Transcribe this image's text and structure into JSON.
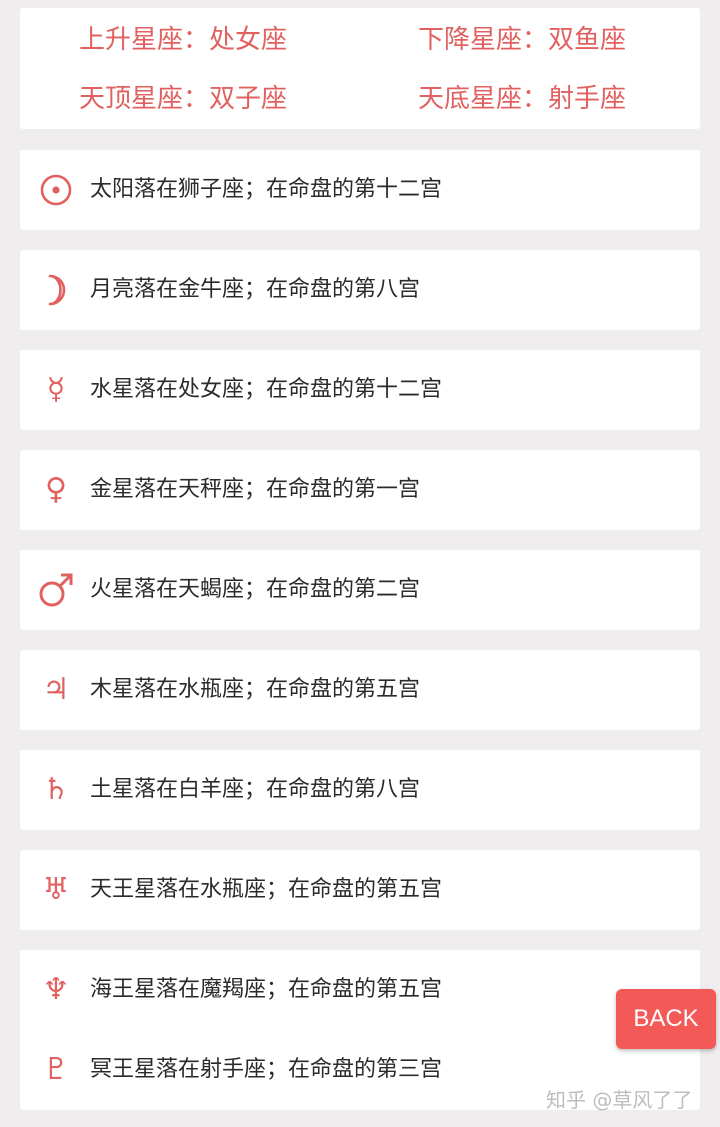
{
  "angles": {
    "ascendant": "上升星座：处女座",
    "descendant": "下降星座：双鱼座",
    "midheaven": "天顶星座：双子座",
    "imum_coeli": "天底星座：射手座"
  },
  "planets": [
    {
      "icon": "sun-icon",
      "glyph": "☉",
      "text": "太阳落在狮子座；在命盘的第十二宫"
    },
    {
      "icon": "moon-icon",
      "glyph": "☽",
      "text": "月亮落在金牛座；在命盘的第八宫"
    },
    {
      "icon": "mercury-icon",
      "glyph": "☿",
      "text": "水星落在处女座；在命盘的第十二宫"
    },
    {
      "icon": "venus-icon",
      "glyph": "♀",
      "text": "金星落在天秤座；在命盘的第一宫"
    },
    {
      "icon": "mars-icon",
      "glyph": "♂",
      "text": "火星落在天蝎座；在命盘的第二宫"
    },
    {
      "icon": "jupiter-icon",
      "glyph": "♃",
      "text": "木星落在水瓶座；在命盘的第五宫"
    },
    {
      "icon": "saturn-icon",
      "glyph": "♄",
      "text": "土星落在白羊座；在命盘的第八宫"
    },
    {
      "icon": "uranus-icon",
      "glyph": "♅",
      "text": "天王星落在水瓶座；在命盘的第五宫"
    },
    {
      "icon": "neptune-icon",
      "glyph": "♆",
      "text": "海王星落在魔羯座；在命盘的第五宫"
    },
    {
      "icon": "pluto-icon",
      "glyph": "♇",
      "text": "冥王星落在射手座；在命盘的第三宫"
    }
  ],
  "back_button": {
    "label": "BACK"
  },
  "watermark": "知乎 @草风了了",
  "colors": {
    "accent": "#e0615f",
    "button": "#f25957",
    "background": "#efedee"
  }
}
